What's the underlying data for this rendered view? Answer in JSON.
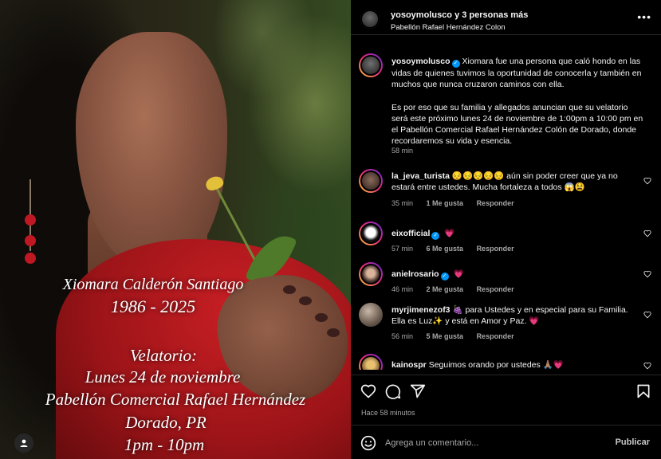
{
  "photo": {
    "overlay": {
      "name": "Xiomara Calderón Santiago",
      "years": "1986 - 2025",
      "velatorio": "Velatorio:",
      "date": "Lunes 24 de noviembre",
      "venue": "Pabellón Comercial Rafael Hernández",
      "city": "Dorado, PR",
      "time": "1pm - 10pm"
    },
    "user_tag_icon": "person-icon"
  },
  "header": {
    "account": "yosoymolusco",
    "others": " y 3 personas más",
    "location": "Pabellón Rafael Hernández Colon"
  },
  "caption": {
    "username": "yosoymolusco",
    "paragraph1": "Xiomara fue una persona que caló hondo en las vidas de quienes tuvimos la oportunidad de conocerla y también en muchos que nunca cruzaron caminos con ella.",
    "paragraph2": "Es por eso que su familia y allegados anuncian que su velatorio será este próximo lunes 24 de noviembre de 1:00pm a 10:00 pm en el Pabellón Comercial Rafael Hernández Colón de Dorado, donde recordaremos su vida y esencia.",
    "time": "58 min"
  },
  "comments": [
    {
      "username": "la_jeva_turista",
      "text": "😔😔😔😔😔 aún sin poder creer que ya no estará entre ustedes. Mucha fortaleza a todos 😱😫",
      "time": "35 min",
      "likes": "1 Me gusta",
      "reply": "Responder",
      "verified": false
    },
    {
      "username": "eixofficial",
      "text": "💗",
      "time": "57 min",
      "likes": "6 Me gusta",
      "reply": "Responder",
      "verified": true
    },
    {
      "username": "anielrosario",
      "text": "💗",
      "time": "46 min",
      "likes": "2 Me gusta",
      "reply": "Responder",
      "verified": true
    },
    {
      "username": "myrjimenezof3",
      "text": "🍇 para Ustedes y en especial para su Familia. Ella es Luz✨ y está en Amor y Paz. 💗",
      "time": "56 min",
      "likes": "5 Me gusta",
      "reply": "Responder",
      "verified": false
    },
    {
      "username": "kainospr",
      "text": "Seguimos orando por ustedes 🙏🏽💗",
      "time": "",
      "likes": "",
      "reply": "",
      "verified": false
    }
  ],
  "actions": {
    "timestamp": "Hace 58 minutos",
    "icons": [
      "heart-icon",
      "comment-icon",
      "share-icon",
      "bookmark-icon"
    ]
  },
  "add_comment": {
    "placeholder": "Agrega un comentario...",
    "publish_label": "Publicar"
  },
  "colors": {
    "background": "#000000",
    "text": "#f5f5f5",
    "muted": "#a8a8a8",
    "verified": "#0095f6",
    "divider": "#262626"
  }
}
